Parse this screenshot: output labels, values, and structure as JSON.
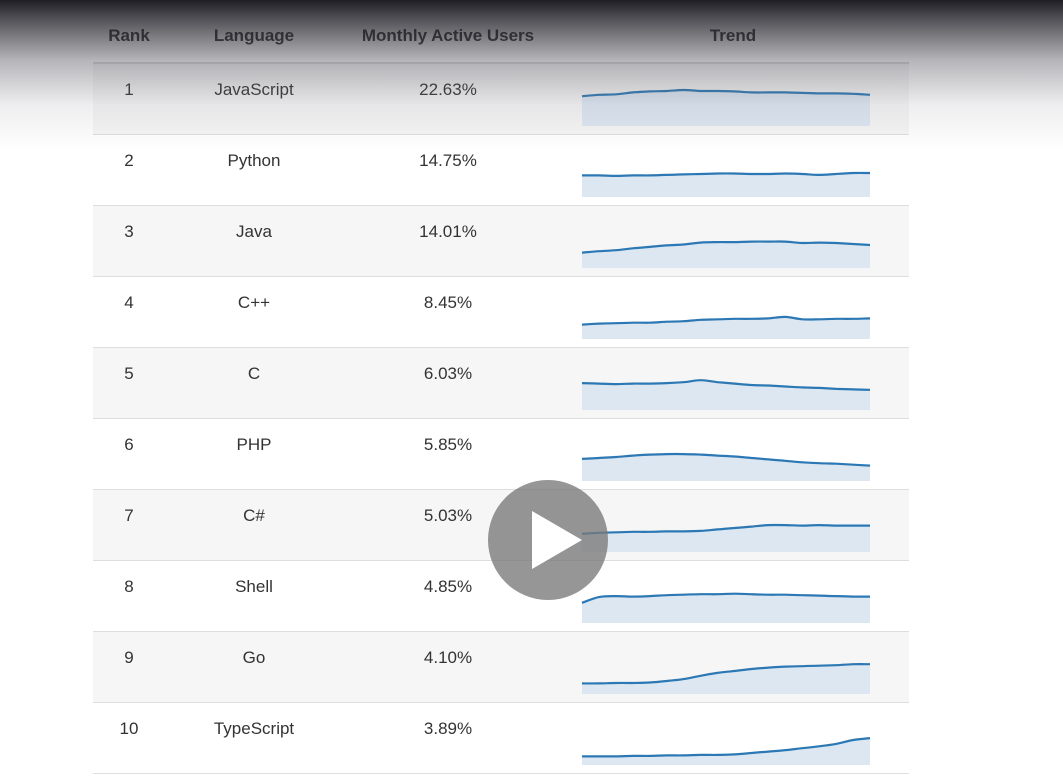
{
  "table": {
    "columns": {
      "rank": "Rank",
      "language": "Language",
      "users": "Monthly Active Users",
      "trend": "Trend"
    },
    "rows": [
      {
        "rank": "1",
        "language": "JavaScript",
        "users": "22.63%",
        "trend": [
          0.62,
          0.65,
          0.66,
          0.7,
          0.72,
          0.73,
          0.75,
          0.73,
          0.73,
          0.72,
          0.7,
          0.7,
          0.7,
          0.69,
          0.68,
          0.68,
          0.67,
          0.65
        ]
      },
      {
        "rank": "2",
        "language": "Python",
        "users": "14.75%",
        "trend": [
          0.45,
          0.45,
          0.44,
          0.45,
          0.45,
          0.46,
          0.47,
          0.48,
          0.49,
          0.49,
          0.48,
          0.48,
          0.49,
          0.48,
          0.46,
          0.48,
          0.5,
          0.5
        ]
      },
      {
        "rank": "3",
        "language": "Java",
        "users": "14.01%",
        "trend": [
          0.32,
          0.35,
          0.37,
          0.41,
          0.44,
          0.47,
          0.49,
          0.53,
          0.54,
          0.54,
          0.55,
          0.55,
          0.55,
          0.52,
          0.53,
          0.52,
          0.5,
          0.48
        ]
      },
      {
        "rank": "4",
        "language": "C++",
        "users": "8.45%",
        "trend": [
          0.3,
          0.32,
          0.33,
          0.34,
          0.34,
          0.36,
          0.37,
          0.4,
          0.41,
          0.42,
          0.42,
          0.43,
          0.46,
          0.41,
          0.41,
          0.42,
          0.42,
          0.43
        ]
      },
      {
        "rank": "5",
        "language": "C",
        "users": "6.03%",
        "trend": [
          0.56,
          0.55,
          0.54,
          0.55,
          0.55,
          0.56,
          0.58,
          0.62,
          0.58,
          0.55,
          0.52,
          0.51,
          0.49,
          0.47,
          0.46,
          0.44,
          0.43,
          0.42
        ]
      },
      {
        "rank": "6",
        "language": "PHP",
        "users": "5.85%",
        "trend": [
          0.46,
          0.48,
          0.5,
          0.53,
          0.55,
          0.56,
          0.56,
          0.55,
          0.53,
          0.51,
          0.48,
          0.45,
          0.42,
          0.39,
          0.37,
          0.36,
          0.34,
          0.32
        ]
      },
      {
        "rank": "7",
        "language": "C#",
        "users": "5.03%",
        "trend": [
          0.38,
          0.4,
          0.41,
          0.42,
          0.42,
          0.43,
          0.43,
          0.44,
          0.47,
          0.5,
          0.53,
          0.56,
          0.56,
          0.55,
          0.56,
          0.55,
          0.55,
          0.55
        ]
      },
      {
        "rank": "8",
        "language": "Shell",
        "users": "4.85%",
        "trend": [
          0.42,
          0.54,
          0.56,
          0.55,
          0.56,
          0.58,
          0.59,
          0.6,
          0.6,
          0.61,
          0.6,
          0.59,
          0.59,
          0.58,
          0.57,
          0.56,
          0.55,
          0.55
        ]
      },
      {
        "rank": "9",
        "language": "Go",
        "users": "4.10%",
        "trend": [
          0.22,
          0.22,
          0.23,
          0.23,
          0.24,
          0.27,
          0.31,
          0.38,
          0.44,
          0.48,
          0.52,
          0.55,
          0.57,
          0.58,
          0.59,
          0.6,
          0.62,
          0.62
        ]
      },
      {
        "rank": "10",
        "language": "TypeScript",
        "users": "3.89%",
        "trend": [
          0.18,
          0.18,
          0.18,
          0.19,
          0.19,
          0.2,
          0.2,
          0.21,
          0.21,
          0.22,
          0.25,
          0.28,
          0.31,
          0.35,
          0.39,
          0.44,
          0.52,
          0.56
        ]
      }
    ]
  },
  "colors": {
    "sparkline_line": "#2c78b4",
    "sparkline_fill": "#dde7f2",
    "row_stripe": "#f6f6f6"
  },
  "overlay": {
    "play_icon": "play-icon"
  }
}
